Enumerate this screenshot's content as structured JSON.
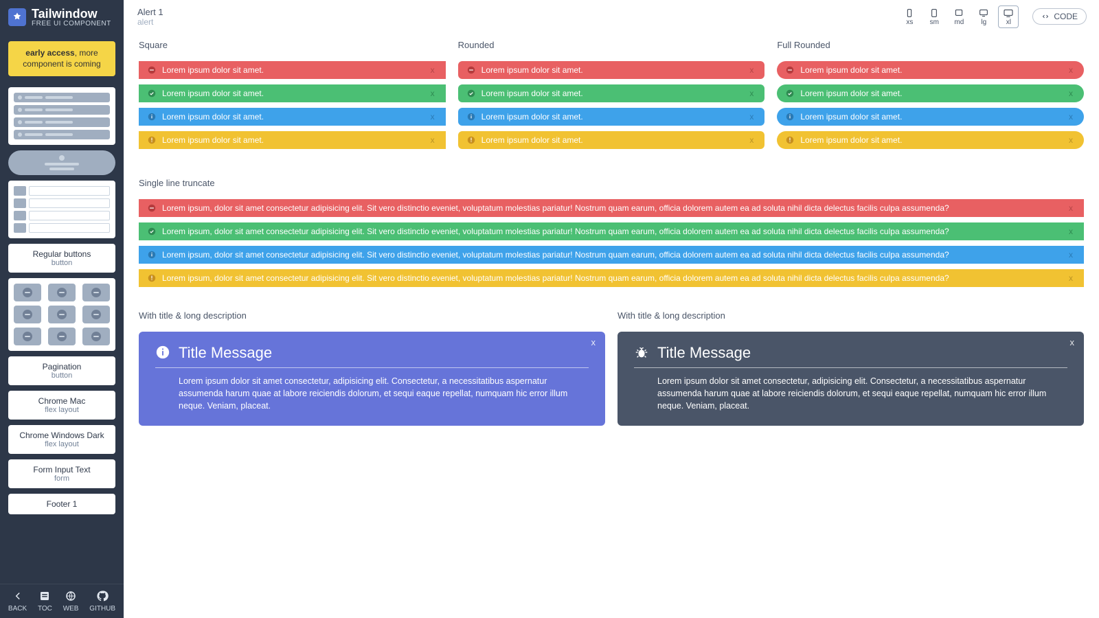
{
  "brand": {
    "name": "Tailwindow",
    "sub": "FREE UI COMPONENT"
  },
  "early": {
    "bold": "early access",
    "rest": ", more component is coming"
  },
  "sidebar_items": [
    {
      "kind": "preview-list"
    },
    {
      "kind": "preview-pill"
    },
    {
      "kind": "preview-table"
    },
    {
      "kind": "text",
      "title": "Regular buttons",
      "sub": "button"
    },
    {
      "kind": "preview-grid"
    },
    {
      "kind": "text",
      "title": "Pagination",
      "sub": "button"
    },
    {
      "kind": "text",
      "title": "Chrome Mac",
      "sub": "flex layout"
    },
    {
      "kind": "text",
      "title": "Chrome Windows Dark",
      "sub": "flex layout"
    },
    {
      "kind": "text",
      "title": "Form Input Text",
      "sub": "form"
    },
    {
      "kind": "text",
      "title": "Footer 1",
      "sub": ""
    }
  ],
  "footer_nav": [
    "BACK",
    "TOC",
    "WEB",
    "GITHUB"
  ],
  "crumb": {
    "title": "Alert 1",
    "sub": "alert"
  },
  "devices": [
    {
      "name": "xs",
      "active": false
    },
    {
      "name": "sm",
      "active": false
    },
    {
      "name": "md",
      "active": false
    },
    {
      "name": "lg",
      "active": false
    },
    {
      "name": "xl",
      "active": true
    }
  ],
  "code_btn": "CODE",
  "labels": {
    "square": "Square",
    "rounded": "Rounded",
    "fullrounded": "Full Rounded",
    "truncate": "Single line truncate",
    "card1": "With title & long description",
    "card2": "With title & long description"
  },
  "alert_text": "Lorem ipsum dolor sit amet.",
  "long_text": "Lorem ipsum, dolor sit amet consectetur adipisicing elit. Sit vero distinctio eveniet, voluptatum molestias pariatur! Nostrum quam earum, officia dolorem autem ea ad soluta nihil dicta delectus facilis culpa assumenda?",
  "close_x": "x",
  "card": {
    "title": "Title Message",
    "desc": "Lorem ipsum dolor sit amet consectetur, adipisicing elit. Consectetur, a necessitatibus aspernatur assumenda harum quae at labore reiciendis dolorum, et sequi eaque repellat, numquam hic error illum neque. Veniam, placeat."
  },
  "colors": [
    "red",
    "green",
    "blue",
    "yellow"
  ]
}
